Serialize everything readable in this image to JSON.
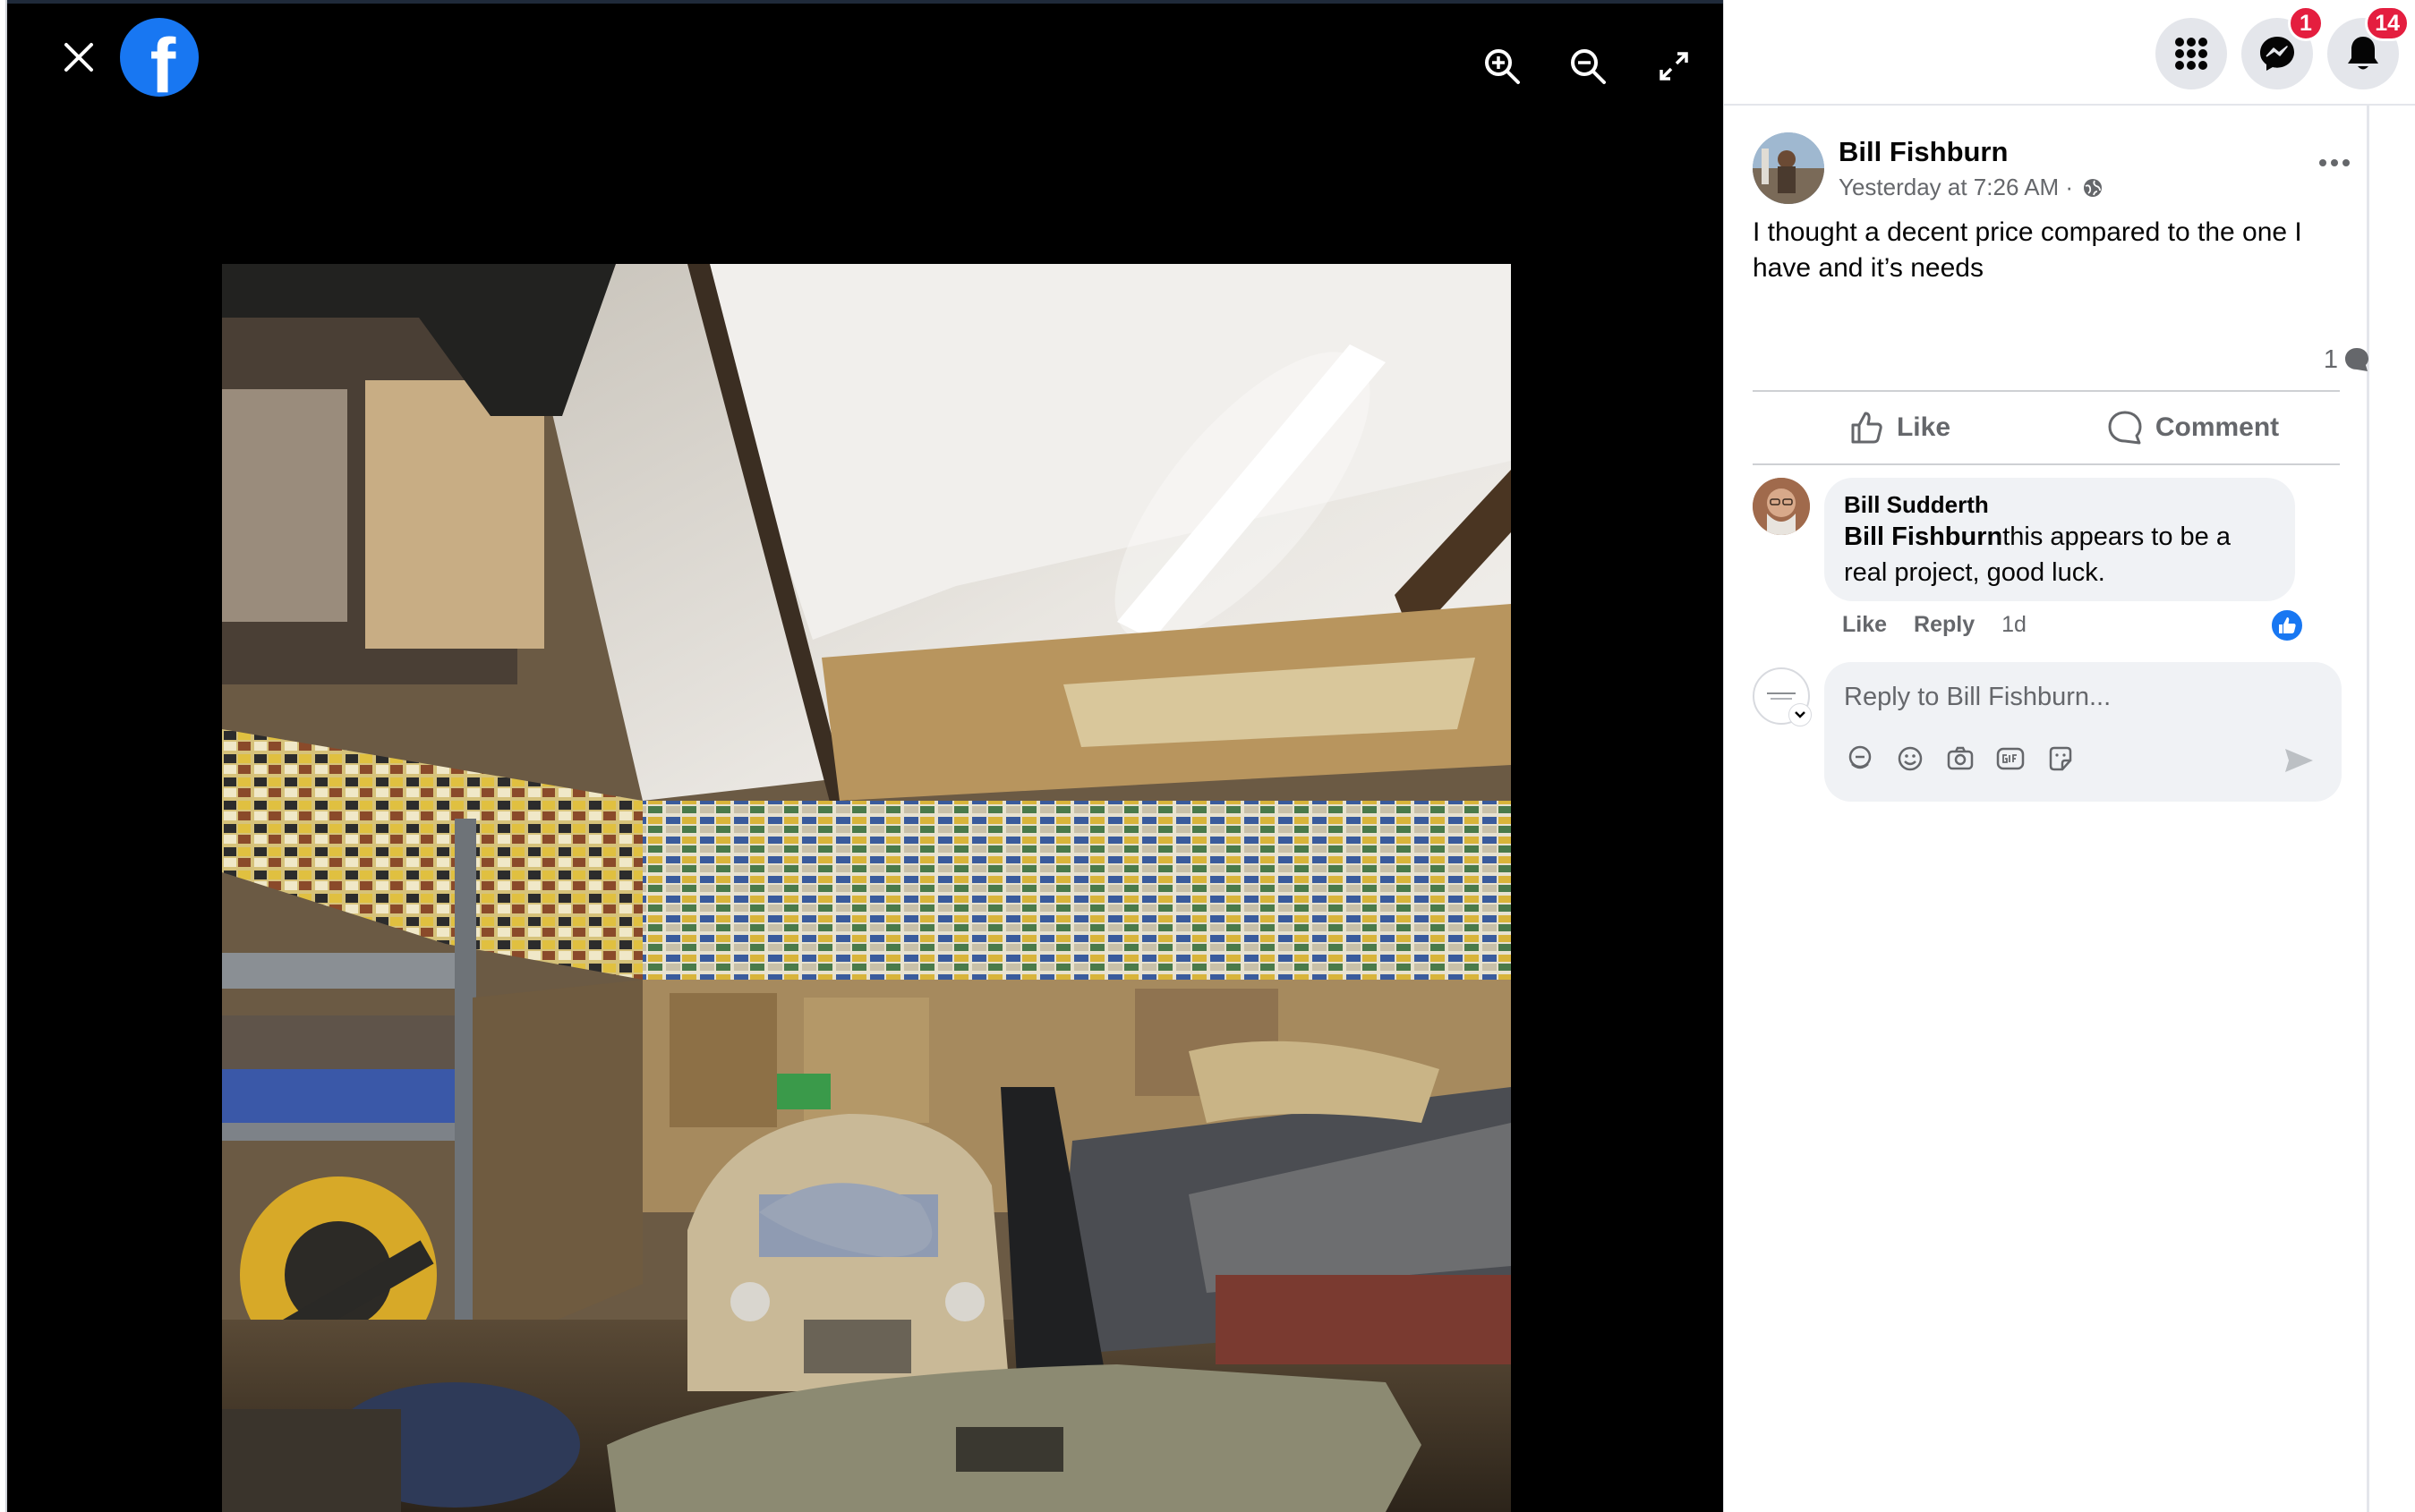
{
  "viewer": {
    "close_icon": "close-icon",
    "logo_letter": "f",
    "zoom_in_icon": "zoom-in-icon",
    "zoom_out_icon": "zoom-out-icon",
    "fullscreen_icon": "fullscreen-icon",
    "photo_alt": "Garage full of old cars and license plates"
  },
  "topbar": {
    "menu_icon": "grid-menu-icon",
    "messenger_icon": "messenger-icon",
    "messenger_badge": "1",
    "notifications_icon": "bell-icon",
    "notifications_badge": "14"
  },
  "post": {
    "author": "Bill Fishburn",
    "timestamp": "Yesterday at 7:26 AM ·",
    "audience_icon": "globe-icon",
    "text": "I thought a decent price compared to the one I have and it’s needs",
    "comment_count": "1",
    "like_label": "Like",
    "comment_label": "Comment"
  },
  "comments": [
    {
      "author": "Bill Sudderth",
      "mention": "Bill Fishburn",
      "text": "this appears to be a real project, good luck.",
      "like_label": "Like",
      "reply_label": "Reply",
      "time": "1d"
    }
  ],
  "reply_box": {
    "placeholder": "Reply to Bill Fishburn..."
  },
  "colors": {
    "brand": "#1877f2",
    "badge": "#e41e3f",
    "secondary_text": "#65676b"
  }
}
